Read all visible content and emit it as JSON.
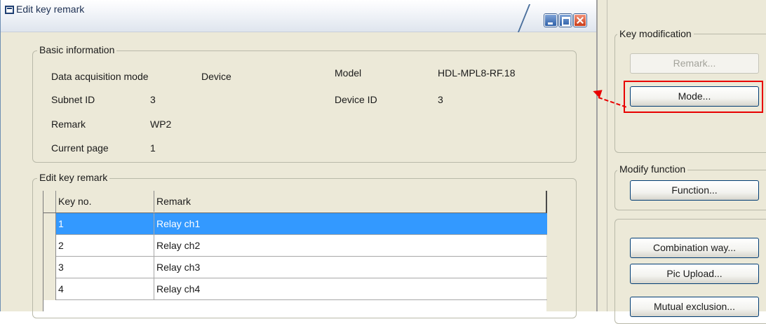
{
  "window": {
    "title": "Edit key remark"
  },
  "basic_info": {
    "legend": "Basic information",
    "data_acquisition_mode_label": "Data acquisition mode",
    "data_acquisition_mode_value": "Device",
    "model_label": "Model",
    "model_value": "HDL-MPL8-RF.18",
    "subnet_id_label": "Subnet ID",
    "subnet_id_value": "3",
    "device_id_label": "Device ID",
    "device_id_value": "3",
    "remark_label": "Remark",
    "remark_value": "WP2",
    "current_page_label": "Current page",
    "current_page_value": "1"
  },
  "edit_key_remark": {
    "legend": "Edit key remark",
    "columns": [
      "Key no.",
      "Remark"
    ],
    "rows": [
      {
        "key_no": "1",
        "remark": "Relay ch1",
        "selected": true
      },
      {
        "key_no": "2",
        "remark": "Relay ch2",
        "selected": false
      },
      {
        "key_no": "3",
        "remark": "Relay ch3",
        "selected": false
      },
      {
        "key_no": "4",
        "remark": "Relay ch4",
        "selected": false
      }
    ]
  },
  "key_modification": {
    "legend": "Key modification",
    "remark_button": "Remark...",
    "mode_button": "Mode..."
  },
  "modify_function": {
    "legend": "Modify function",
    "function_button": "Function..."
  },
  "other_actions": {
    "combination_button": "Combination way...",
    "pic_upload_button": "Pic Upload...",
    "mutual_exclusion_button": "Mutual exclusion..."
  },
  "colors": {
    "selection": "#3399ff",
    "dialog_bg": "#ece9d8",
    "annotation_red": "#e80000"
  }
}
